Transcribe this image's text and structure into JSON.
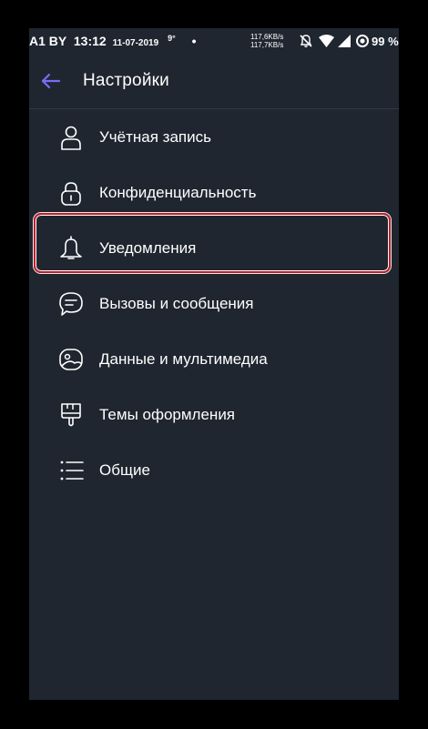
{
  "status_bar": {
    "carrier": "A1 BY",
    "time": "13:12",
    "date": "11-07-2019",
    "temperature": "9°",
    "dot": "•",
    "speed_up": "117,6KB/s",
    "speed_down": "117,7KB/s",
    "battery": "99 %"
  },
  "toolbar": {
    "back_icon": "arrow-left-icon",
    "title": "Настройки",
    "accent_color": "#7b6cf6"
  },
  "menu": {
    "items": [
      {
        "icon": "person-icon",
        "label": "Учётная запись"
      },
      {
        "icon": "lock-icon",
        "label": "Конфиденциальность"
      },
      {
        "icon": "bell-icon",
        "label": "Уведомления",
        "highlighted": true
      },
      {
        "icon": "chat-bubble-icon",
        "label": "Вызовы и сообщения"
      },
      {
        "icon": "image-icon",
        "label": "Данные и мультимедиа"
      },
      {
        "icon": "paint-brush-icon",
        "label": "Темы оформления"
      },
      {
        "icon": "list-icon",
        "label": "Общие"
      }
    ]
  },
  "colors": {
    "background": "#1f2630",
    "text": "#ffffff",
    "highlight_border": "#c41e2a"
  }
}
